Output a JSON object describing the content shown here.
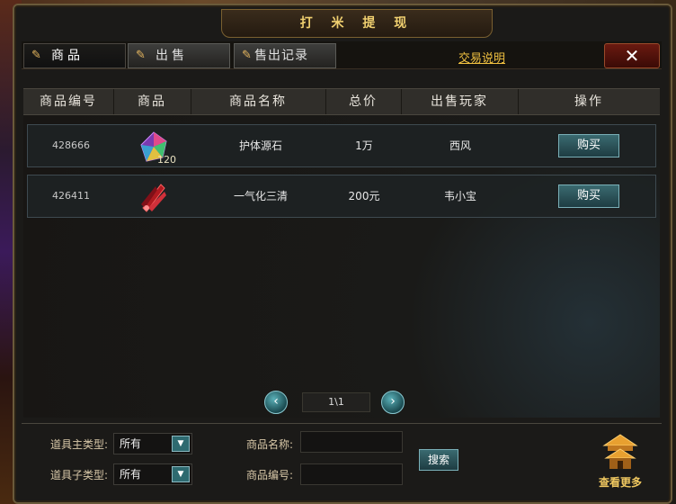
{
  "window": {
    "title": "打 米 提 现"
  },
  "tabs": [
    {
      "label": "商品"
    },
    {
      "label": "出售"
    },
    {
      "label": "售出记录"
    }
  ],
  "trade_guide_link": "交易说明",
  "close_icon": "close-icon",
  "table": {
    "columns": [
      "商品编号",
      "商品",
      "商品名称",
      "总价",
      "出售玩家",
      "操作"
    ],
    "rows": [
      {
        "id": "428666",
        "icon": "gem-icon",
        "qty": "120",
        "name": "护体源石",
        "price": "1万",
        "seller": "西风",
        "action": "购买"
      },
      {
        "id": "426411",
        "icon": "blade-icon",
        "qty": "",
        "name": "一气化三清",
        "price": "200元",
        "seller": "韦小宝",
        "action": "购买"
      }
    ]
  },
  "pager": {
    "page": "1\\1"
  },
  "filters": {
    "main_type_label": "道具主类型:",
    "main_type_value": "所有",
    "sub_type_label": "道具子类型:",
    "sub_type_value": "所有",
    "name_label": "商品名称:",
    "name_value": "",
    "code_label": "商品编号:",
    "code_value": "",
    "search_label": "搜索",
    "more_label": "查看更多"
  },
  "colors": {
    "accent_gold": "#f0c040",
    "button_teal": "#2e6a70"
  }
}
